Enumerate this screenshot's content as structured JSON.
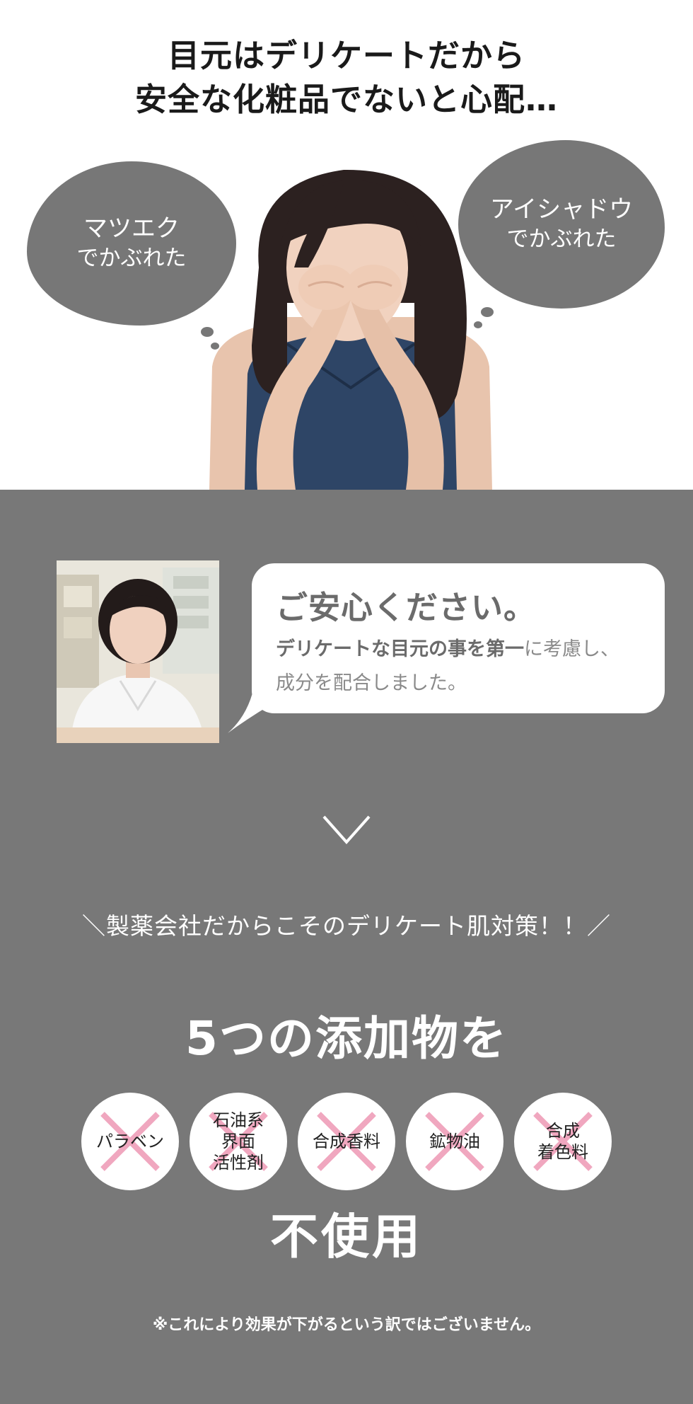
{
  "headline": {
    "line1": "目元はデリケートだから",
    "line2": "安全な化粧品でないと心配…"
  },
  "bubble_left": {
    "line1": "マツエク",
    "line2": "でかぶれた"
  },
  "bubble_right": {
    "line1": "アイシャドウ",
    "line2": "でかぶれた"
  },
  "speech": {
    "title": "ご安心ください。",
    "body_bold": "デリケートな目元の事を第一",
    "body_rest1": "に考慮し、",
    "body_line2": "成分を配合しました。"
  },
  "tagline": "＼製薬会社だからこそのデリケート肌対策！！／",
  "heading_top": "5つの添加物を",
  "additives": [
    {
      "label": "パラベン"
    },
    {
      "label": "石油系\n界面\n活性剤"
    },
    {
      "label": "合成香料"
    },
    {
      "label": "鉱物油"
    },
    {
      "label": "合成\n着色料"
    }
  ],
  "heading_bottom": "不使用",
  "note": "※これにより効果が下がるという訳ではございません。",
  "colors": {
    "panel": "#787878",
    "bubble": "#777777",
    "cross": "#f0a7bf"
  }
}
